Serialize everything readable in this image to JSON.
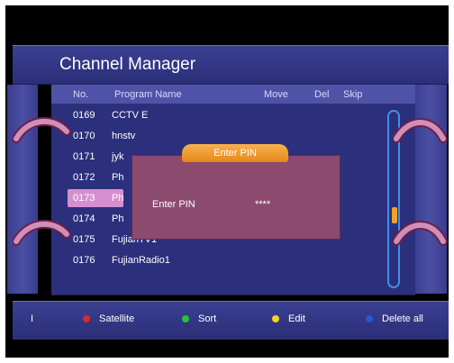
{
  "header": {
    "title": "Channel Manager"
  },
  "columns": {
    "no": "No.",
    "program_name": "Program Name",
    "move": "Move",
    "del": "Del",
    "skip": "Skip"
  },
  "rows": [
    {
      "number": "0169",
      "name": "CCTV E"
    },
    {
      "number": "0170",
      "name": "hnstv"
    },
    {
      "number": "0171",
      "name": "jyk"
    },
    {
      "number": "0172",
      "name": "Ph"
    },
    {
      "number": "0173",
      "name": "Ph",
      "selected": true
    },
    {
      "number": "0174",
      "name": "Ph"
    },
    {
      "number": "0175",
      "name": "FujianTV1"
    },
    {
      "number": "0176",
      "name": "FujianRadio1"
    }
  ],
  "dialog": {
    "title": "Enter PIN",
    "label": "Enter PIN",
    "value": "****"
  },
  "footer": {
    "marker": "I",
    "keys": [
      {
        "label": "Satellite",
        "color": "#e0262e"
      },
      {
        "label": "Sort",
        "color": "#25c23a"
      },
      {
        "label": "Edit",
        "color": "#f3d41e"
      },
      {
        "label": "Delete all",
        "color": "#2458d8"
      }
    ]
  },
  "icons": [
    "up-arrow-icon",
    "down-arrow-icon",
    "left-arrow-icon",
    "right-arrow-icon"
  ],
  "scroll": {
    "position_fraction": 0.6
  },
  "colors": {
    "panel": "#2c2f7c",
    "header": "#3a3f92",
    "selected": "#d58fcf",
    "dialog": "#8c4a6f",
    "dialog_tab": "#f2a325"
  }
}
